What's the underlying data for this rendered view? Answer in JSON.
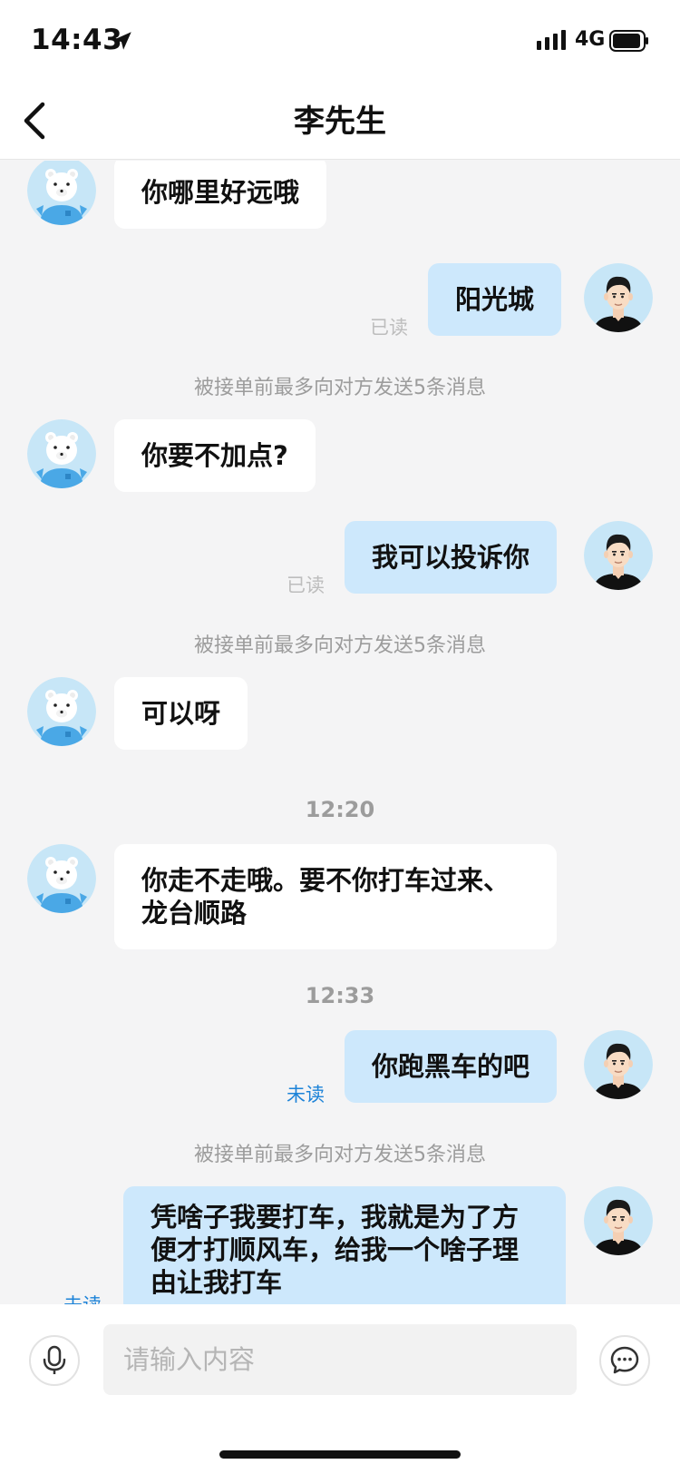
{
  "status_bar": {
    "time": "14:43",
    "network": "4G"
  },
  "header": {
    "title": "李先生"
  },
  "messages": [
    {
      "side": "left",
      "text": "你哪里好远哦"
    },
    {
      "side": "right",
      "text": "阳光城",
      "read_status": "已读"
    },
    {
      "side": "left",
      "text": "你要不加点?"
    },
    {
      "side": "right",
      "text": "我可以投诉你",
      "read_status": "已读"
    },
    {
      "side": "left",
      "text": "可以呀"
    },
    {
      "side": "left",
      "text": "你走不走哦。要不你打车过来、龙台顺路"
    },
    {
      "side": "right",
      "text": "你跑黑车的吧",
      "read_status": "未读"
    },
    {
      "side": "right",
      "text": "凭啥子我要打车，我就是为了方便才打顺风车，给我一个啥子理由让我打车",
      "read_status": "未读"
    }
  ],
  "system_notes": [
    "被接单前最多向对方发送5条消息",
    "被接单前最多向对方发送5条消息",
    "被接单前最多向对方发送5条消息"
  ],
  "timestamps": [
    "12:20",
    "12:33"
  ],
  "input": {
    "placeholder": "请输入内容",
    "value": ""
  },
  "icons": {
    "back": "chevron-left-icon",
    "mic": "microphone-icon",
    "emoji": "chat-bubble-icon",
    "location": "location-arrow-icon",
    "signal": "signal-icon",
    "battery": "battery-icon"
  },
  "colors": {
    "self_bubble": "#cde8fc",
    "other_bubble": "#ffffff",
    "unread": "#1d83d8",
    "read": "#bdbdbd",
    "background": "#f4f4f5"
  }
}
